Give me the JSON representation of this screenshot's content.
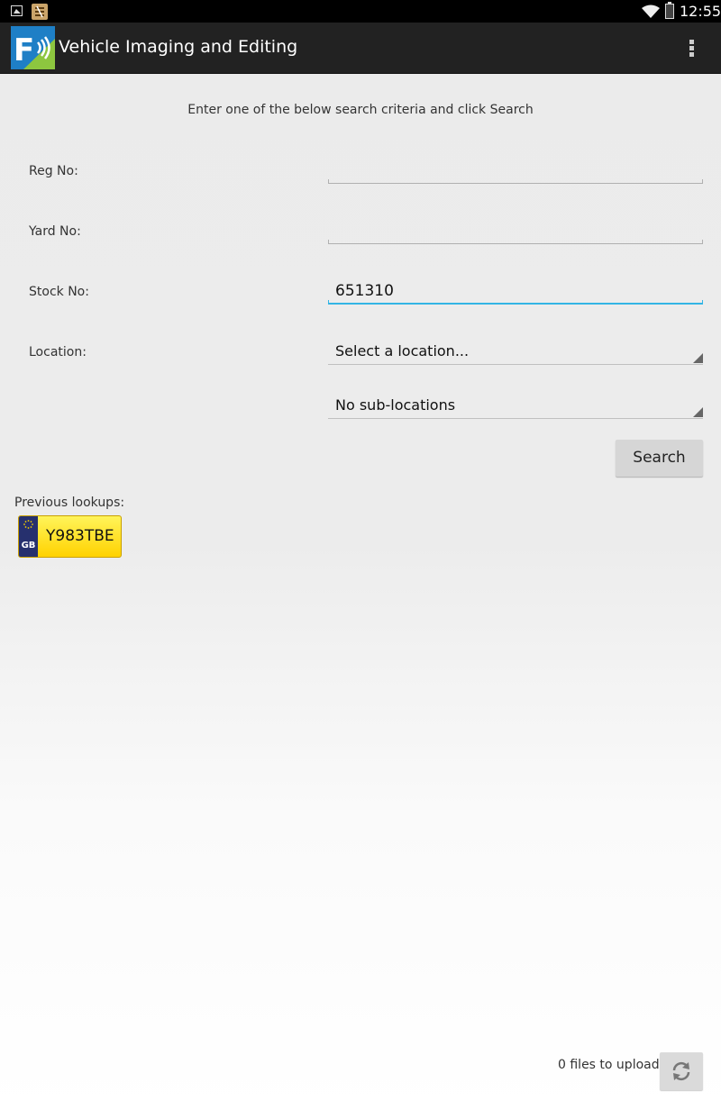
{
  "status_bar": {
    "time": "12:55",
    "icons": [
      "gallery-icon",
      "app-notification-icon",
      "wifi-icon",
      "battery-icon"
    ]
  },
  "action_bar": {
    "title": "Vehicle Imaging and Editing",
    "logo_letter": "F",
    "menu_icon": "overflow-menu-icon"
  },
  "form": {
    "instructions": "Enter one of the below search criteria and click Search",
    "reg_no": {
      "label": "Reg No:",
      "value": ""
    },
    "yard_no": {
      "label": "Yard No:",
      "value": ""
    },
    "stock_no": {
      "label": "Stock No:",
      "value": "651310"
    },
    "location": {
      "label": "Location:",
      "selected": "Select a location..."
    },
    "sub_location": {
      "selected": "No sub-locations"
    },
    "search_label": "Search"
  },
  "previous_lookups": {
    "label": "Previous lookups:",
    "items": [
      {
        "country": "GB",
        "plate": "Y983TBE"
      }
    ]
  },
  "footer": {
    "upload_status": "0 files to upload",
    "sync_icon": "sync-icon"
  },
  "colors": {
    "accent": "#33b5e5",
    "action_bar": "#222222",
    "plate_yellow": "#ffd200",
    "plate_band": "#26306e"
  }
}
